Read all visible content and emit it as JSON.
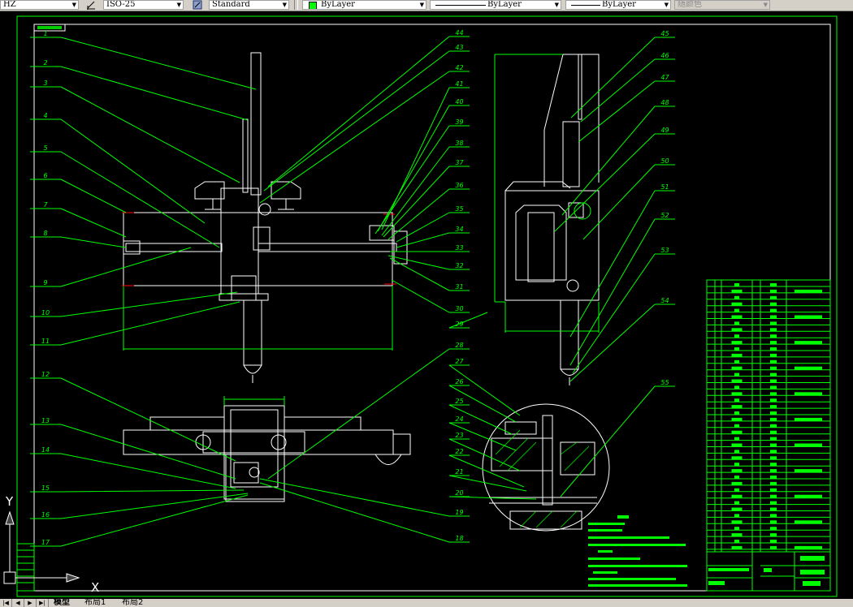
{
  "toolbar": {
    "text_style": "HZ",
    "dim_style": "ISO-25",
    "table_style": "Standard",
    "layer": "ByLayer",
    "layer_color": "#00ff00",
    "linetype": "ByLayer",
    "lineweight": "ByLayer",
    "plot_color": "随颜色"
  },
  "drawing": {
    "background": "#000000",
    "line_color": "#ffffff",
    "annotation_color": "#00ff00",
    "left_balloons": [
      "1",
      "2",
      "3",
      "4",
      "5",
      "6",
      "7",
      "8",
      "9",
      "10",
      "11",
      "12",
      "13",
      "14",
      "15",
      "16",
      "17"
    ],
    "right_balloons": [
      "44",
      "43",
      "42",
      "41",
      "40",
      "39",
      "38",
      "37",
      "36",
      "35",
      "34",
      "33",
      "32",
      "31",
      "30",
      "29",
      "28",
      "27",
      "26",
      "25",
      "24",
      "23",
      "22",
      "21",
      "20",
      "19",
      "18"
    ],
    "side_balloons": [
      "45",
      "46",
      "47",
      "48",
      "49",
      "50",
      "51",
      "52",
      "53",
      "54",
      "55"
    ]
  },
  "ucs": {
    "x_label": "X",
    "y_label": "Y"
  },
  "layout_tabs": {
    "tabs": [
      "模型",
      "布局1",
      "布局2"
    ],
    "active": "模型"
  }
}
